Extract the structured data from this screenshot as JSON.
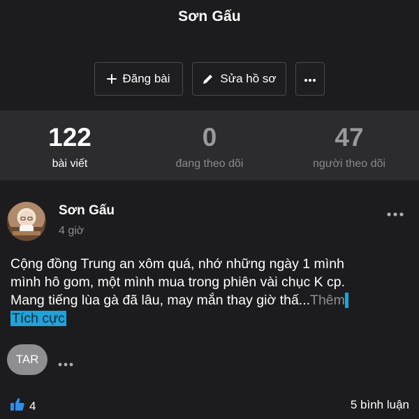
{
  "profile": {
    "name": "Sơn Gấu"
  },
  "actions": {
    "post_label": "Đăng bài",
    "edit_label": "Sửa hồ sơ"
  },
  "stats": [
    {
      "value": "122",
      "label": "bài viết"
    },
    {
      "value": "0",
      "label": "đang theo dõi"
    },
    {
      "value": "47",
      "label": "người theo dõi"
    }
  ],
  "post": {
    "author": "Sơn Gấu",
    "time": "4 giờ",
    "text_line1": "Cộng đồng Trung an xôm quá, nhớ những ngày 1 mình",
    "text_line2": "mình hô gom, một mình mua trong phiên vài chục K cp.",
    "text_line3": "Mang tiếng lùa gà đã lâu, may mắn thay giờ thấ...",
    "more": "Thêm",
    "sentiment": "Tích cực",
    "tag_button": "TAR",
    "likes": "4",
    "comments": "5 bình luận"
  },
  "colors": {
    "background": "#1c1c1e",
    "stats_background": "#2c2c2e",
    "highlight": "#1fa3d8",
    "like_blue": "#2d8cf0"
  },
  "icons": [
    "plus-icon",
    "pencil-icon",
    "more-dots-icon",
    "thumbs-up-icon"
  ]
}
